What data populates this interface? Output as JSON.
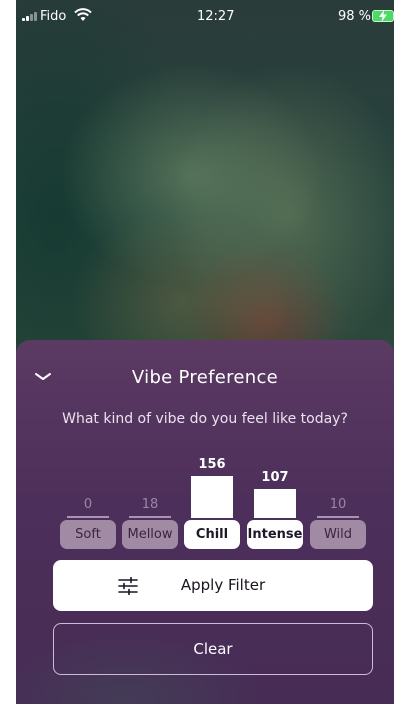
{
  "status_bar": {
    "carrier": "Fido",
    "time": "12:27",
    "battery": "98 %"
  },
  "sheet": {
    "title": "Vibe Preference",
    "question": "What kind of vibe do you feel like today?",
    "vibes": [
      {
        "label": "Soft",
        "count": "0",
        "level": 0.0,
        "selected": false
      },
      {
        "label": "Mellow",
        "count": "18",
        "level": 0.05,
        "selected": false
      },
      {
        "label": "Chill",
        "count": "156",
        "level": 1.0,
        "selected": true
      },
      {
        "label": "Intense",
        "count": "107",
        "level": 0.69,
        "selected": true
      },
      {
        "label": "Wild",
        "count": "10",
        "level": 0.03,
        "selected": false
      }
    ],
    "apply_label": "Apply Filter",
    "clear_label": "Clear"
  },
  "colors": {
    "sheet_background": "#4c2f5a",
    "selected_chip": "#ffffff",
    "unselected_chip": "#a08aa4"
  }
}
